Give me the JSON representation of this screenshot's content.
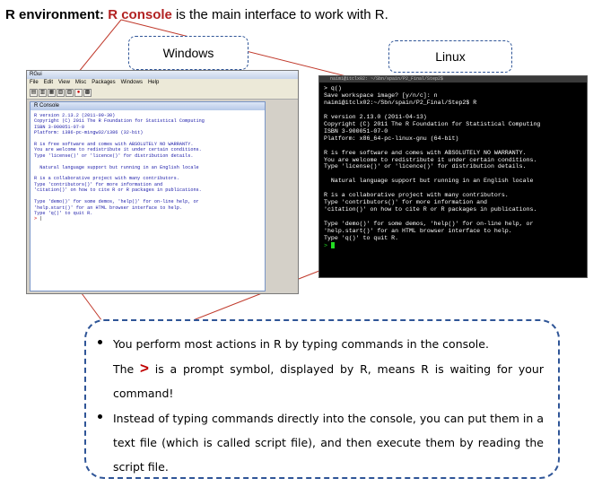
{
  "header": {
    "prefix": "R environment:",
    "highlight": "R console",
    "suffix": " is the main interface to work with R."
  },
  "labels": {
    "windows": "Windows",
    "linux": "Linux"
  },
  "windows_app": {
    "title": "RGui",
    "menu": [
      "File",
      "Edit",
      "View",
      "Misc",
      "Packages",
      "Windows",
      "Help"
    ],
    "console_title": "R Console",
    "console_text": "R version 2.13.2 (2011-09-30)\nCopyright (C) 2011 The R Foundation for Statistical Computing\nISBN 3-900051-07-0\nPlatform: i386-pc-mingw32/i386 (32-bit)\n\nR is free software and comes with ABSOLUTELY NO WARRANTY.\nYou are welcome to redistribute it under certain conditions.\nType 'license()' or 'licence()' for distribution details.\n\n  Natural language support but running in an English locale\n\nR is a collaborative project with many contributors.\nType 'contributors()' for more information and\n'citation()' on how to cite R or R packages in publications.\n\nType 'demo()' for some demos, 'help()' for on-line help, or\n'help.start()' for an HTML browser interface to help.\nType 'q()' to quit R.\n",
    "prompt": ">"
  },
  "linux_app": {
    "title": "naimi@itclx02: ~/Sbn/spain/P2_Final/Step2$",
    "console_text": "> q()\nSave workspace image? [y/n/c]: n\nnaimi@itclx02:~/Sbn/spain/P2_Final/Step2$ R\n\nR version 2.13.0 (2011-04-13)\nCopyright (C) 2011 The R Foundation for Statistical Computing\nISBN 3-900051-07-0\nPlatform: x86_64-pc-linux-gnu (64-bit)\n\nR is free software and comes with ABSOLUTELY NO WARRANTY.\nYou are welcome to redistribute it under certain conditions.\nType 'license()' or 'licence()' for distribution details.\n\n  Natural language support but running in an English locale\n\nR is a collaborative project with many contributors.\nType 'contributors()' for more information and\n'citation()' on how to cite R or R packages in publications.\n\nType 'demo()' for some demos, 'help()' for on-line help, or\n'help.start()' for an HTML browser interface to help.\nType 'q()' to quit R.\n",
    "prompt": ">"
  },
  "callout": {
    "bullet1_a": "You perform most actions in R by typing commands in the console.",
    "bullet1_b_pre": "The ",
    "prompt_symbol": ">",
    "bullet1_b_post": " is a prompt symbol, displayed by R, means R is waiting for your command!",
    "bullet2": "Instead of typing commands directly into the console, you can put them in a text file (which is called script file), and then execute them by reading the script file."
  },
  "colors": {
    "accent_red": "#b22222",
    "dash_blue": "#2f5597",
    "win_text_blue": "#1a1aa8",
    "terminal_green": "#22dd22"
  }
}
